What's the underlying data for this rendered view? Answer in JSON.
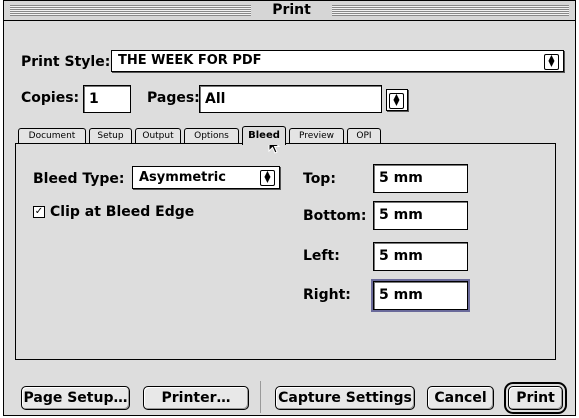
{
  "window": {
    "title": "Print"
  },
  "top": {
    "print_style_label": "Print Style:",
    "print_style_value": "THE WEEK FOR PDF",
    "copies_label": "Copies:",
    "copies_value": "1",
    "pages_label": "Pages:",
    "pages_value": "All"
  },
  "tabs": [
    {
      "label": "Document"
    },
    {
      "label": "Setup"
    },
    {
      "label": "Output"
    },
    {
      "label": "Options"
    },
    {
      "label": "Bleed",
      "active": true
    },
    {
      "label": "Preview"
    },
    {
      "label": "OPI"
    }
  ],
  "bleed": {
    "type_label": "Bleed Type:",
    "type_value": "Asymmetric",
    "clip_label": "Clip at Bleed Edge",
    "clip_checked": true,
    "top_label": "Top:",
    "top_value": "5 mm",
    "bottom_label": "Bottom:",
    "bottom_value": "5 mm",
    "left_label": "Left:",
    "left_value": "5 mm",
    "right_label": "Right:",
    "right_value": "5 mm"
  },
  "buttons": {
    "page_setup": "Page Setup…",
    "printer": "Printer…",
    "capture_settings": "Capture Settings",
    "cancel": "Cancel",
    "print": "Print"
  },
  "icons": {
    "popup_arrows": "up-down-arrows-icon",
    "check": "checkmark-icon",
    "cursor": "arrow-cursor-icon"
  }
}
